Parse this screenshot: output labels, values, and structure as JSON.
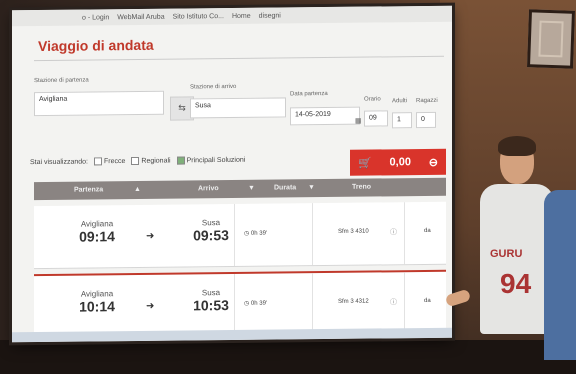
{
  "browser": {
    "bookmarks": [
      "o - Login",
      "WebMail Aruba",
      "Sito Istituto Co...",
      "Home",
      "disegni"
    ]
  },
  "page": {
    "title": "Viaggio di andata"
  },
  "search": {
    "departure_label": "Stazione di partenza",
    "departure_value": "Avigliana",
    "arrival_label": "Stazione di arrivo",
    "arrival_value": "Susa",
    "date_label": "Data partenza",
    "date_value": "14-05-2019",
    "time_label": "Orario",
    "time_value": "09",
    "adults_label": "Adulti",
    "adults_value": "1",
    "kids_label": "Ragazzi",
    "kids_value": "0"
  },
  "filters": {
    "label": "Stai visualizzando:",
    "options": [
      "Frecce",
      "Regionali",
      "Principali Soluzioni"
    ],
    "checked": [
      false,
      false,
      true
    ]
  },
  "cart": {
    "total": "0,00"
  },
  "table": {
    "headers": [
      "Partenza",
      "Arrivo",
      "Durata",
      "Treno"
    ],
    "rows": [
      {
        "from": "Avigliana",
        "dep": "09:14",
        "to": "Susa",
        "arr": "09:53",
        "duration": "0h 39'",
        "train": "Sfm 3 4310",
        "note": "da"
      },
      {
        "from": "Avigliana",
        "dep": "10:14",
        "to": "Susa",
        "arr": "10:53",
        "duration": "0h 39'",
        "train": "Sfm 3 4312",
        "note": "da"
      }
    ]
  },
  "scene": {
    "shirt_text": "GURU",
    "shirt_number": "94"
  }
}
